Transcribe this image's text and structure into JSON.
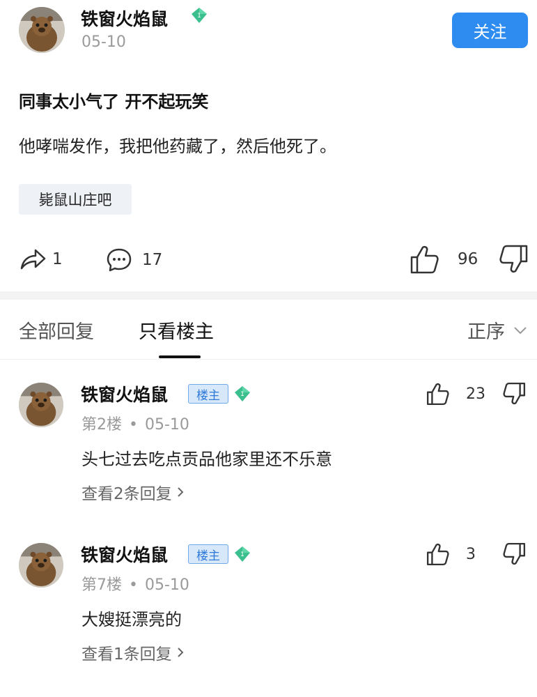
{
  "post": {
    "author": "铁窗火焰鼠",
    "date": "05-10",
    "follow_label": "关注",
    "title": "同事太小气了 开不起玩笑",
    "body": "他哮喘发作，我把他药藏了，然后他死了。",
    "forum_tag": "毙鼠山庄吧",
    "share_count": "1",
    "comment_count": "17",
    "like_count": "96"
  },
  "tabs": {
    "all_label": "全部回复",
    "op_label": "只看楼主",
    "sort_label": "正序"
  },
  "replies": [
    {
      "author": "铁窗火焰鼠",
      "op_badge": "楼主",
      "floor": "第2楼",
      "dot": "•",
      "date": "05-10",
      "text": "头七过去吃点贡品他家里还不乐意",
      "view_replies": "查看2条回复",
      "like_count": "23"
    },
    {
      "author": "铁窗火焰鼠",
      "op_badge": "楼主",
      "floor": "第7楼",
      "dot": "•",
      "date": "05-10",
      "text": "大嫂挺漂亮的",
      "view_replies": "查看1条回复",
      "like_count": "3"
    }
  ],
  "colors": {
    "accent": "#2e8cf0",
    "level_badge": "#3cbf8f",
    "op_badge_bg": "#d7e8fb",
    "muted_text": "#9a9a9a"
  },
  "icons": [
    "share-icon",
    "comment-icon",
    "thumbs-up-icon",
    "thumbs-down-icon",
    "chevron-down-icon",
    "chevron-right-icon",
    "diamond-level-icon"
  ]
}
